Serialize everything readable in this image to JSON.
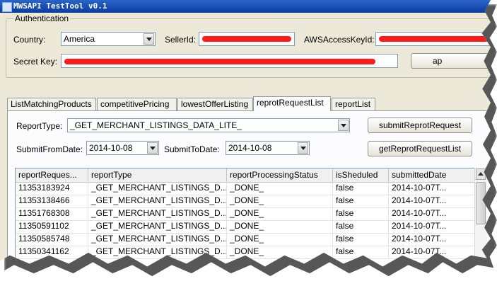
{
  "window": {
    "title": "MWSAPI TestTool v0.1"
  },
  "auth": {
    "legend": "Authentication",
    "country_label": "Country:",
    "country_value": "America",
    "sellerid_label": "SellerId:",
    "aws_label": "AWSAccessKeyId:",
    "secret_label": "Secret Key:",
    "apply_label": "ap"
  },
  "tabs": [
    {
      "label": "ListMatchingProducts"
    },
    {
      "label": "competitivePricing"
    },
    {
      "label": "lowestOfferListing"
    },
    {
      "label": "reprotRequestList"
    },
    {
      "label": "reportList"
    }
  ],
  "report": {
    "reporttype_label": "ReportType:",
    "reporttype_value": "_GET_MERCHANT_LISTINGS_DATA_LITE_",
    "fromdate_label": "SubmitFromDate:",
    "fromdate_value": "2014-10-08",
    "todate_label": "SubmitToDate:",
    "todate_value": "2014-10-08",
    "submit_button": "submitReprotRequest",
    "get_button": "getReprotRequestList"
  },
  "grid": {
    "columns": [
      "reportReques...",
      "reportType",
      "reportProcessingStatus",
      "isSheduled",
      "submittedDate"
    ],
    "rows": [
      [
        "11353183924",
        "_GET_MERCHANT_LISTINGS_D...",
        "_DONE_",
        "false",
        "2014-10-07T..."
      ],
      [
        "11353138466",
        "_GET_MERCHANT_LISTINGS_D...",
        "_DONE_",
        "false",
        "2014-10-07T..."
      ],
      [
        "11351768308",
        "_GET_MERCHANT_LISTINGS_D...",
        "_DONE_",
        "false",
        "2014-10-07T..."
      ],
      [
        "11350591102",
        "_GET_MERCHANT_LISTINGS_D...",
        "_DONE_",
        "false",
        "2014-10-07T..."
      ],
      [
        "11350585748",
        "_GET_MERCHANT_LISTINGS_D...",
        "_DONE_",
        "false",
        "2014-10-07T..."
      ],
      [
        "11350341162",
        "_GET_MERCHANT_LISTINGS_D...",
        "_DONE_",
        "false",
        "2014-10-07T..."
      ]
    ]
  },
  "colors": {
    "redaction": "#ff1a1a",
    "titlebar": "#0a3ca0",
    "window_bg": "#ece9d8"
  }
}
